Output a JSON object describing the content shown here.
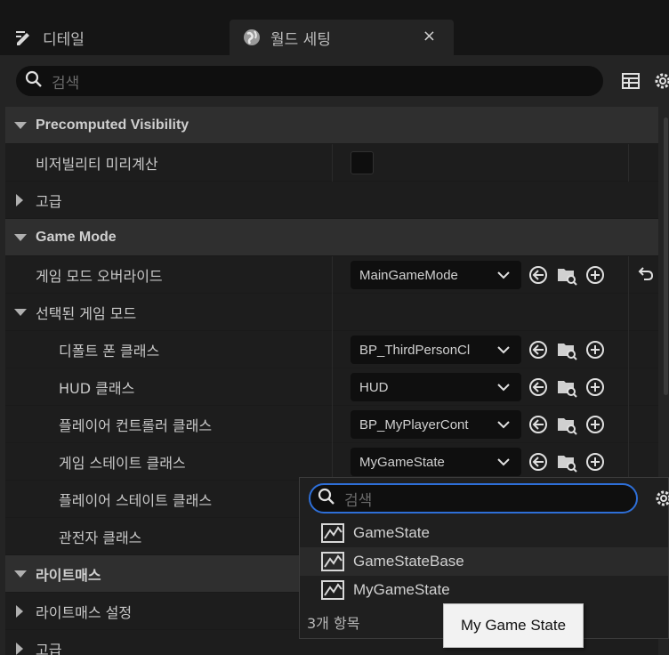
{
  "tabs": [
    {
      "label": "디테일",
      "icon": "pencil-icon"
    },
    {
      "label": "월드 세팅",
      "icon": "globe-icon",
      "close": "×"
    }
  ],
  "search": {
    "placeholder": "검색"
  },
  "sections": {
    "precomputed": {
      "title": "Precomputed Visibility",
      "visibility_label": "비저빌리티 미리계산",
      "advanced_label": "고급"
    },
    "game_mode": {
      "title": "Game Mode",
      "override_label": "게임 모드 오버라이드",
      "override_value": "MainGameMode",
      "selected_label": "선택된 게임 모드",
      "default_pawn_label": "디폴트 폰 클래스",
      "default_pawn_value": "BP_ThirdPersonCl",
      "hud_label": "HUD 클래스",
      "hud_value": "HUD",
      "pc_label": "플레이어 컨트롤러 클래스",
      "pc_value": "BP_MyPlayerCont",
      "gs_label": "게임 스테이트 클래스",
      "gs_value": "MyGameState",
      "ps_label": "플레이어 스테이트 클래스",
      "spectator_label": "관전자 클래스"
    },
    "lightmass": {
      "title": "라이트매스",
      "settings_label": "라이트매스 설정",
      "advanced_label": "고급"
    }
  },
  "popup": {
    "search_placeholder": "검색",
    "items": [
      "GameState",
      "GameStateBase",
      "MyGameState"
    ],
    "count": "3개 항목"
  },
  "tooltip": "My Game State",
  "colors": {
    "accent": "#2e6fd8",
    "panel": "#242424",
    "row": "#1d1d1d",
    "section": "#2f2f2f"
  }
}
